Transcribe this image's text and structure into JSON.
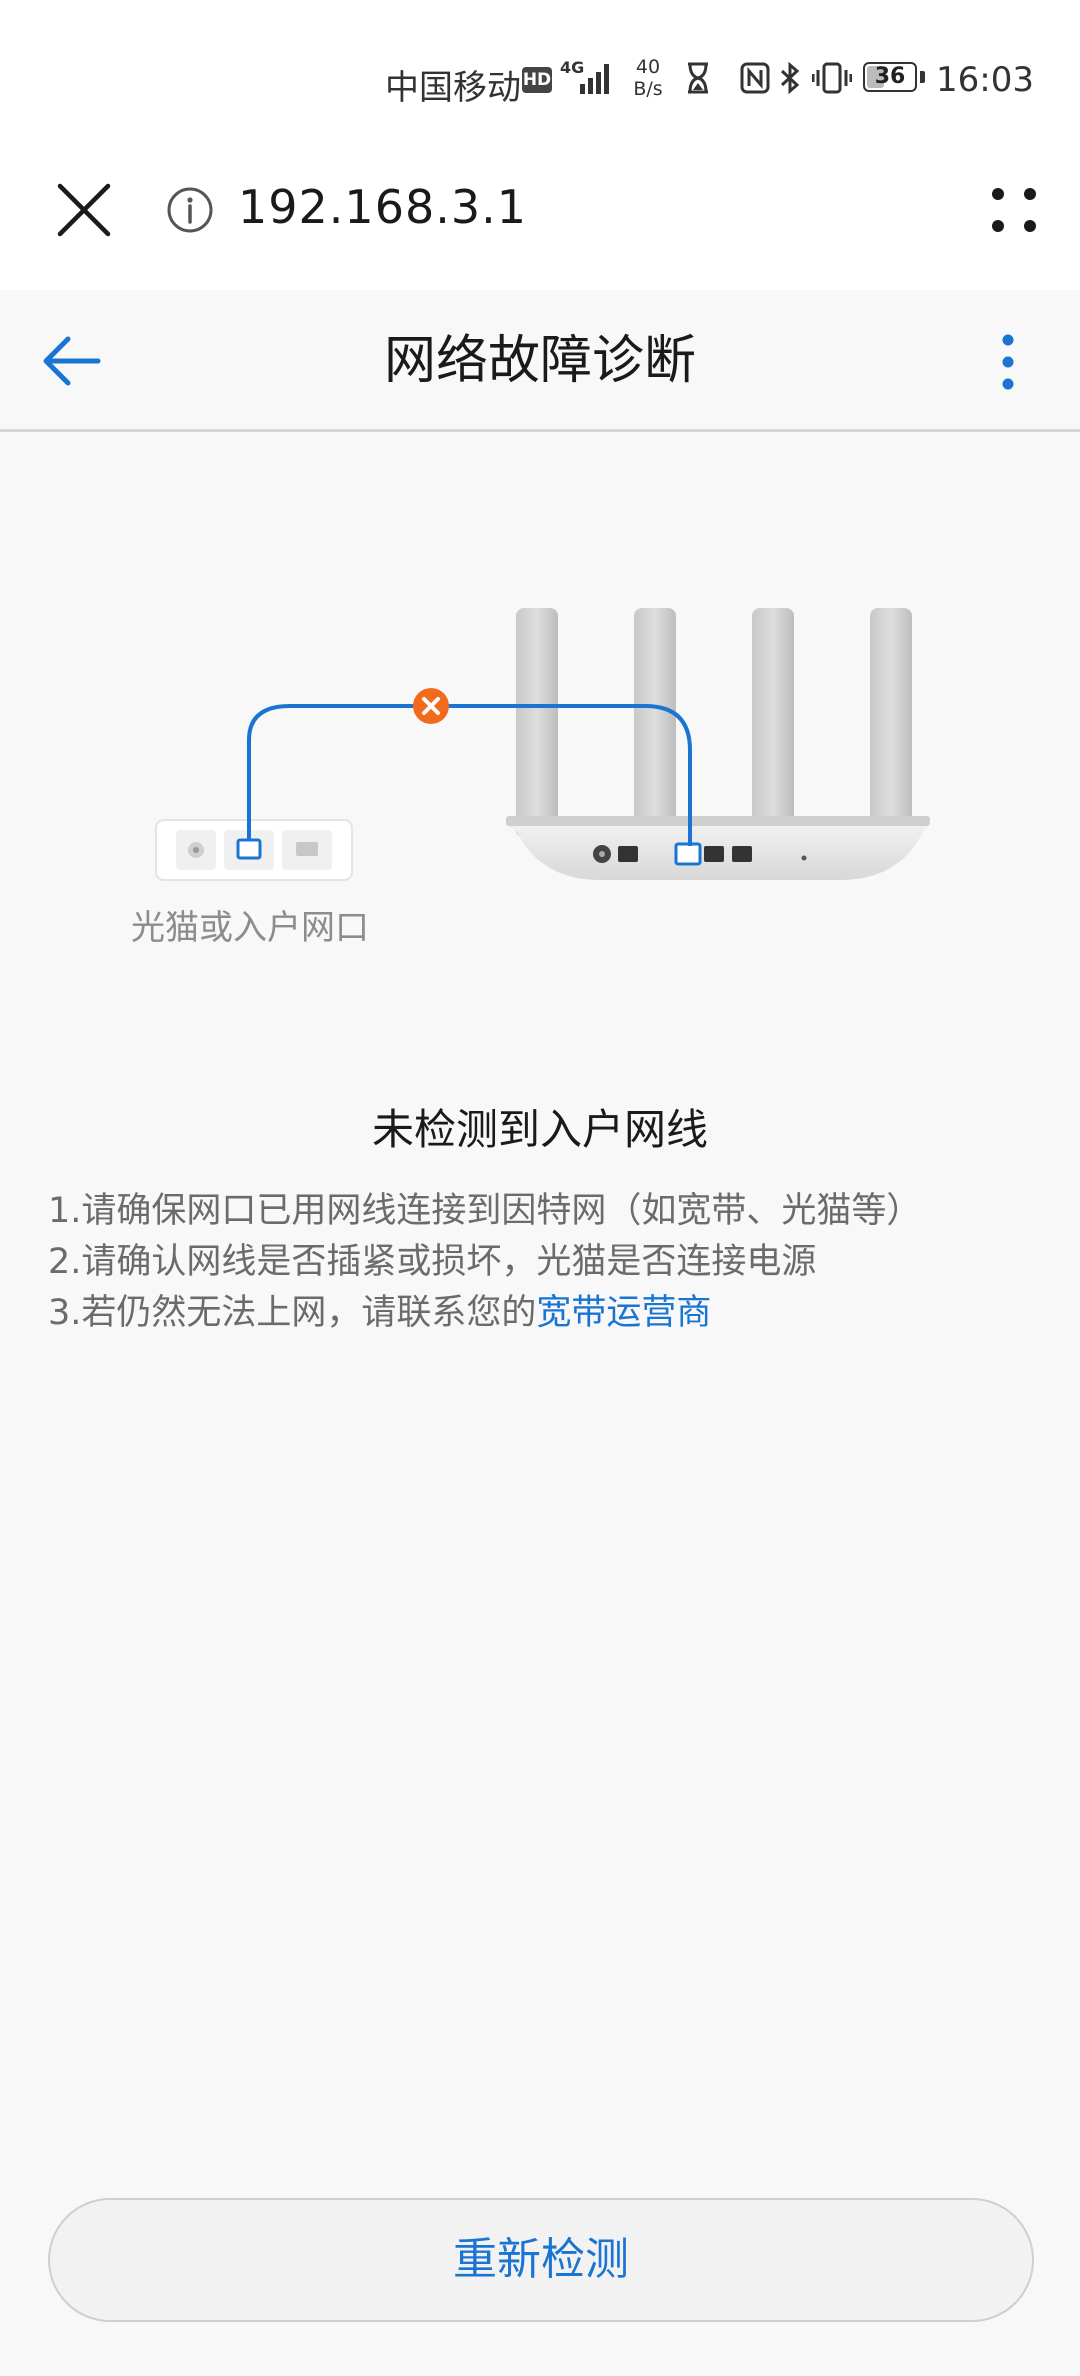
{
  "status_bar": {
    "carrier": "中国移动",
    "hd_badge": "HD",
    "network_type": "4G",
    "speed_value": "40",
    "speed_unit": "B/s",
    "battery": "36",
    "battery_level": 0.36,
    "time": "16:03"
  },
  "browser": {
    "url": "192.168.3.1"
  },
  "header": {
    "title": "网络故障诊断"
  },
  "illustration": {
    "modem_label": "光猫或入户网口",
    "accent_color": "#1a75d2",
    "error_color": "#f26b1d"
  },
  "diagnosis": {
    "title": "未检测到入户网线",
    "tip1": "1.请确保网口已用网线连接到因特网（如宽带、光猫等）",
    "tip2": "2.请确认网线是否插紧或损坏，光猫是否连接电源",
    "tip3_prefix": "3.若仍然无法上网，请联系您的",
    "tip3_link": "宽带运营商"
  },
  "actions": {
    "retry_label": "重新检测"
  }
}
